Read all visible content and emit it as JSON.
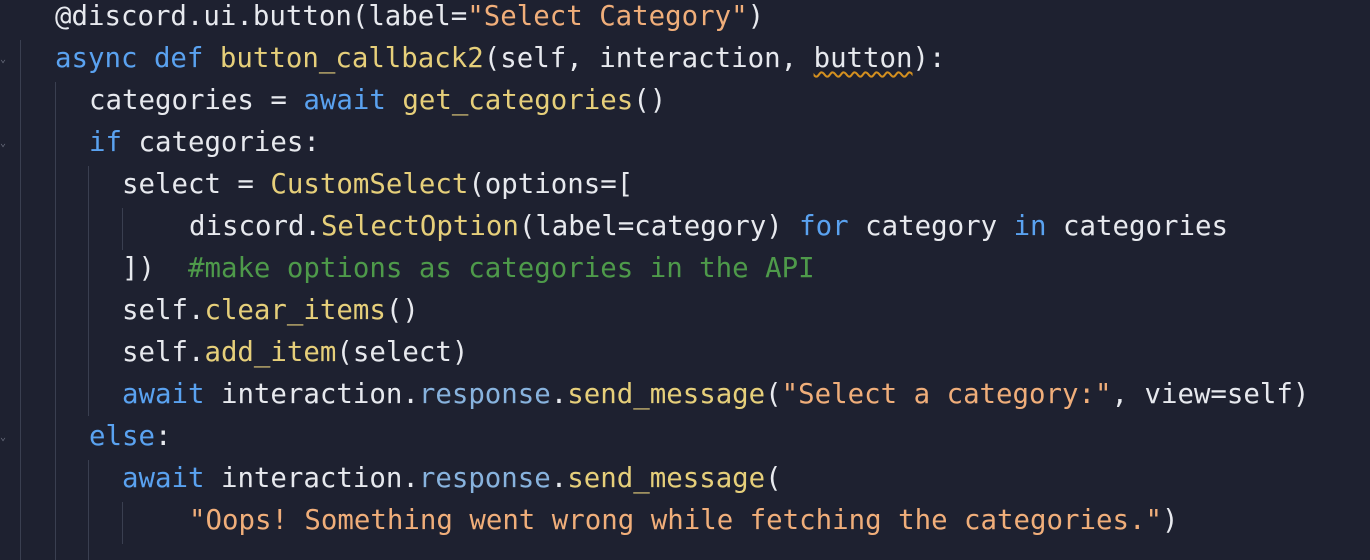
{
  "editor": {
    "theme_colors": {
      "background": "#1e2130",
      "plain": "#e7e9ee",
      "keyword": "#5aa2f0",
      "function": "#e6cf7a",
      "string": "#f0ae7a",
      "property": "#88b3de",
      "comment": "#4e9a4a",
      "warning_squiggle": "#d4901f"
    },
    "gutter": {
      "fold_icon": "fold-chevron-icon"
    },
    "lines": [
      [
        {
          "t": "@discord.ui.button(label=",
          "c": "plain"
        },
        {
          "t": "\"Select Category\"",
          "c": "str"
        },
        {
          "t": ")",
          "c": "plain"
        }
      ],
      [
        {
          "t": "async def ",
          "c": "kw"
        },
        {
          "t": "button_callback2",
          "c": "fn"
        },
        {
          "t": "(self, interaction, ",
          "c": "plain"
        },
        {
          "t": "button",
          "c": "plain",
          "squiggle": true
        },
        {
          "t": "):",
          "c": "plain"
        }
      ],
      [
        {
          "t": "categories = ",
          "c": "plain"
        },
        {
          "t": "await ",
          "c": "kw"
        },
        {
          "t": "get_categories",
          "c": "fn"
        },
        {
          "t": "()",
          "c": "plain"
        }
      ],
      [
        {
          "t": "if ",
          "c": "kw"
        },
        {
          "t": "categories:",
          "c": "plain"
        }
      ],
      [
        {
          "t": "select = ",
          "c": "plain"
        },
        {
          "t": "CustomSelect",
          "c": "fn"
        },
        {
          "t": "(options=[",
          "c": "plain"
        }
      ],
      [
        {
          "t": "discord.",
          "c": "plain"
        },
        {
          "t": "SelectOption",
          "c": "fn"
        },
        {
          "t": "(label=category) ",
          "c": "plain"
        },
        {
          "t": "for ",
          "c": "kw"
        },
        {
          "t": "category ",
          "c": "plain"
        },
        {
          "t": "in ",
          "c": "kw"
        },
        {
          "t": "categories",
          "c": "plain"
        }
      ],
      [
        {
          "t": "])  ",
          "c": "plain"
        },
        {
          "t": "#make options as categories in the API",
          "c": "cm"
        }
      ],
      [
        {
          "t": "self.",
          "c": "plain"
        },
        {
          "t": "clear_items",
          "c": "fn"
        },
        {
          "t": "()",
          "c": "plain"
        }
      ],
      [
        {
          "t": "self.",
          "c": "plain"
        },
        {
          "t": "add_item",
          "c": "fn"
        },
        {
          "t": "(select)",
          "c": "plain"
        }
      ],
      [
        {
          "t": "await ",
          "c": "kw"
        },
        {
          "t": "interaction.",
          "c": "plain"
        },
        {
          "t": "response",
          "c": "prop"
        },
        {
          "t": ".",
          "c": "plain"
        },
        {
          "t": "send_message",
          "c": "fn"
        },
        {
          "t": "(",
          "c": "plain"
        },
        {
          "t": "\"Select a category:\"",
          "c": "str"
        },
        {
          "t": ", view=self)",
          "c": "plain"
        }
      ],
      [
        {
          "t": "else",
          "c": "kw"
        },
        {
          "t": ":",
          "c": "plain"
        }
      ],
      [
        {
          "t": "await ",
          "c": "kw"
        },
        {
          "t": "interaction.",
          "c": "plain"
        },
        {
          "t": "response",
          "c": "prop"
        },
        {
          "t": ".",
          "c": "plain"
        },
        {
          "t": "send_message",
          "c": "fn"
        },
        {
          "t": "(",
          "c": "plain"
        }
      ],
      [
        {
          "t": "\"Oops! Something went wrong while fetching the categories.\"",
          "c": "str"
        },
        {
          "t": ")",
          "c": "plain"
        }
      ]
    ]
  }
}
